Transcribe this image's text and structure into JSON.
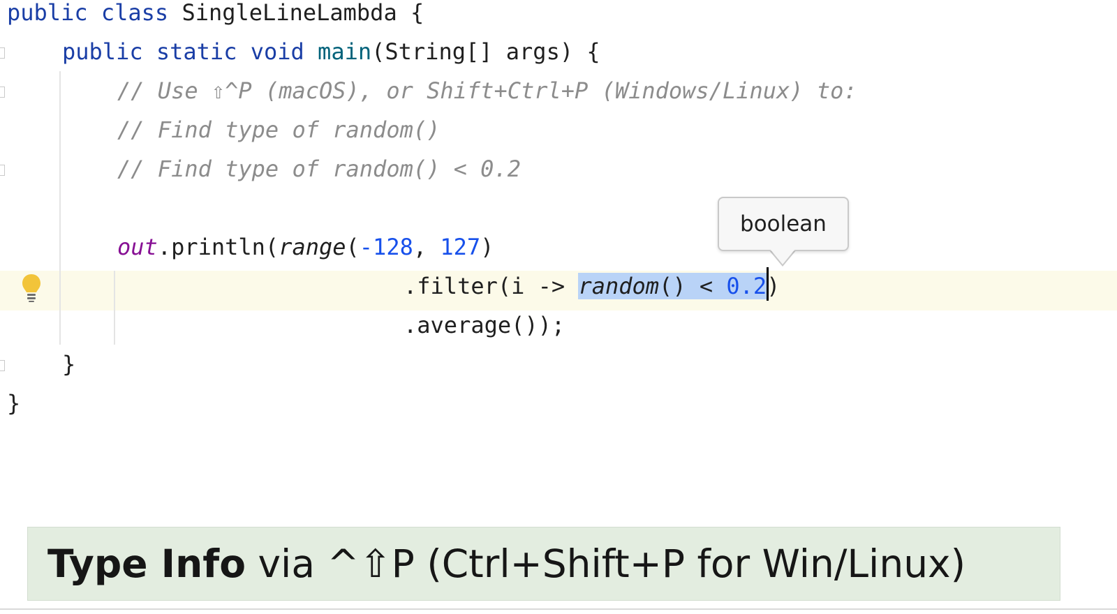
{
  "code": {
    "l1": {
      "kw": "public class",
      "name": " SingleLineLambda {"
    },
    "l2": {
      "kw": "public static void",
      "sp": " ",
      "method": "main",
      "rest": "(String[] args) {"
    },
    "l3": {
      "comment": "// Use ⇧^P (macOS), or Shift+Ctrl+P (Windows/Linux) to:"
    },
    "l4": {
      "comment": "// Find type of random()"
    },
    "l5": {
      "comment": "// Find type of random() < 0.2"
    },
    "l6": {
      "out": "out",
      "println": ".println(",
      "range": "range",
      "open": "(",
      "n1": "-128",
      "comma": ", ",
      "n2": "127",
      "close": ")"
    },
    "l7": {
      "prefix": ".filter(i -> ",
      "sel_random": "random",
      "sel_op": "() < ",
      "sel_num": "0.2",
      "suffix": ")"
    },
    "l8": {
      "text": ".average());"
    },
    "l9": {
      "text": "}"
    },
    "l10": {
      "text": "}"
    }
  },
  "tooltip": {
    "text": "boolean"
  },
  "banner": {
    "title": "Type Info",
    "rest": " via ^⇧P (Ctrl+Shift+P for Win/Linux)"
  },
  "colors": {
    "keyword": "#1a3ea6",
    "method": "#00627a",
    "number": "#1750eb",
    "comment": "#8c8c8c",
    "static": "#871094",
    "selection": "#b9d3f7",
    "banner_bg": "#e3ede0"
  },
  "icons": {
    "gutter": "lightbulb-icon"
  }
}
